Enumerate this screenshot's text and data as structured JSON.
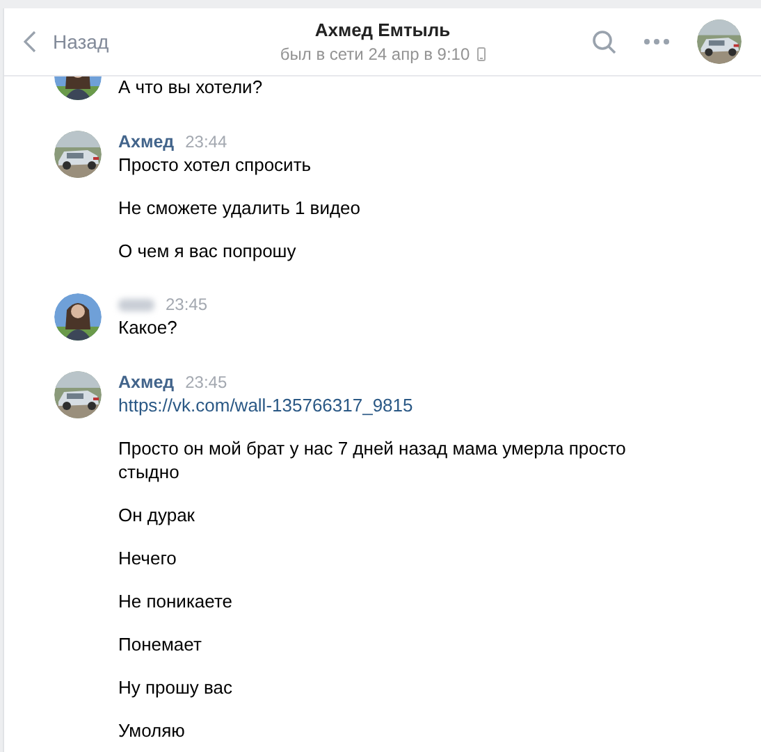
{
  "header": {
    "back": "Назад",
    "title": "Ахмед Емтыль",
    "status": "был в сети 24 апр в 9:10"
  },
  "groups": [
    {
      "kind": "person",
      "messages": [
        {
          "kind": "text",
          "text": "А что вы хотели?"
        }
      ]
    },
    {
      "kind": "car",
      "name": "Ахмед",
      "time": "23:44",
      "messages": [
        {
          "kind": "text",
          "text": "Просто хотел спросить"
        },
        {
          "kind": "text",
          "text": "Не сможете удалить 1 видео"
        },
        {
          "kind": "text",
          "text": "О чем я вас попрошу"
        }
      ]
    },
    {
      "kind": "person",
      "time": "23:45",
      "messages": [
        {
          "kind": "text",
          "text": "Какое?"
        }
      ]
    },
    {
      "kind": "car",
      "name": "Ахмед",
      "time": "23:45",
      "messages": [
        {
          "kind": "link",
          "text": "https://vk.com/wall-135766317_9815"
        },
        {
          "kind": "text",
          "text": "Просто он мой брат у нас 7 дней назад мама умерла просто стыдно"
        },
        {
          "kind": "text",
          "text": "Он дурак"
        },
        {
          "kind": "text",
          "text": "Нечего"
        },
        {
          "kind": "text",
          "text": "Не поникаете"
        },
        {
          "kind": "text",
          "text": "Понемает"
        },
        {
          "kind": "text",
          "text": "Ну прошу вас"
        },
        {
          "kind": "text",
          "text": "Умоляю"
        }
      ]
    }
  ]
}
